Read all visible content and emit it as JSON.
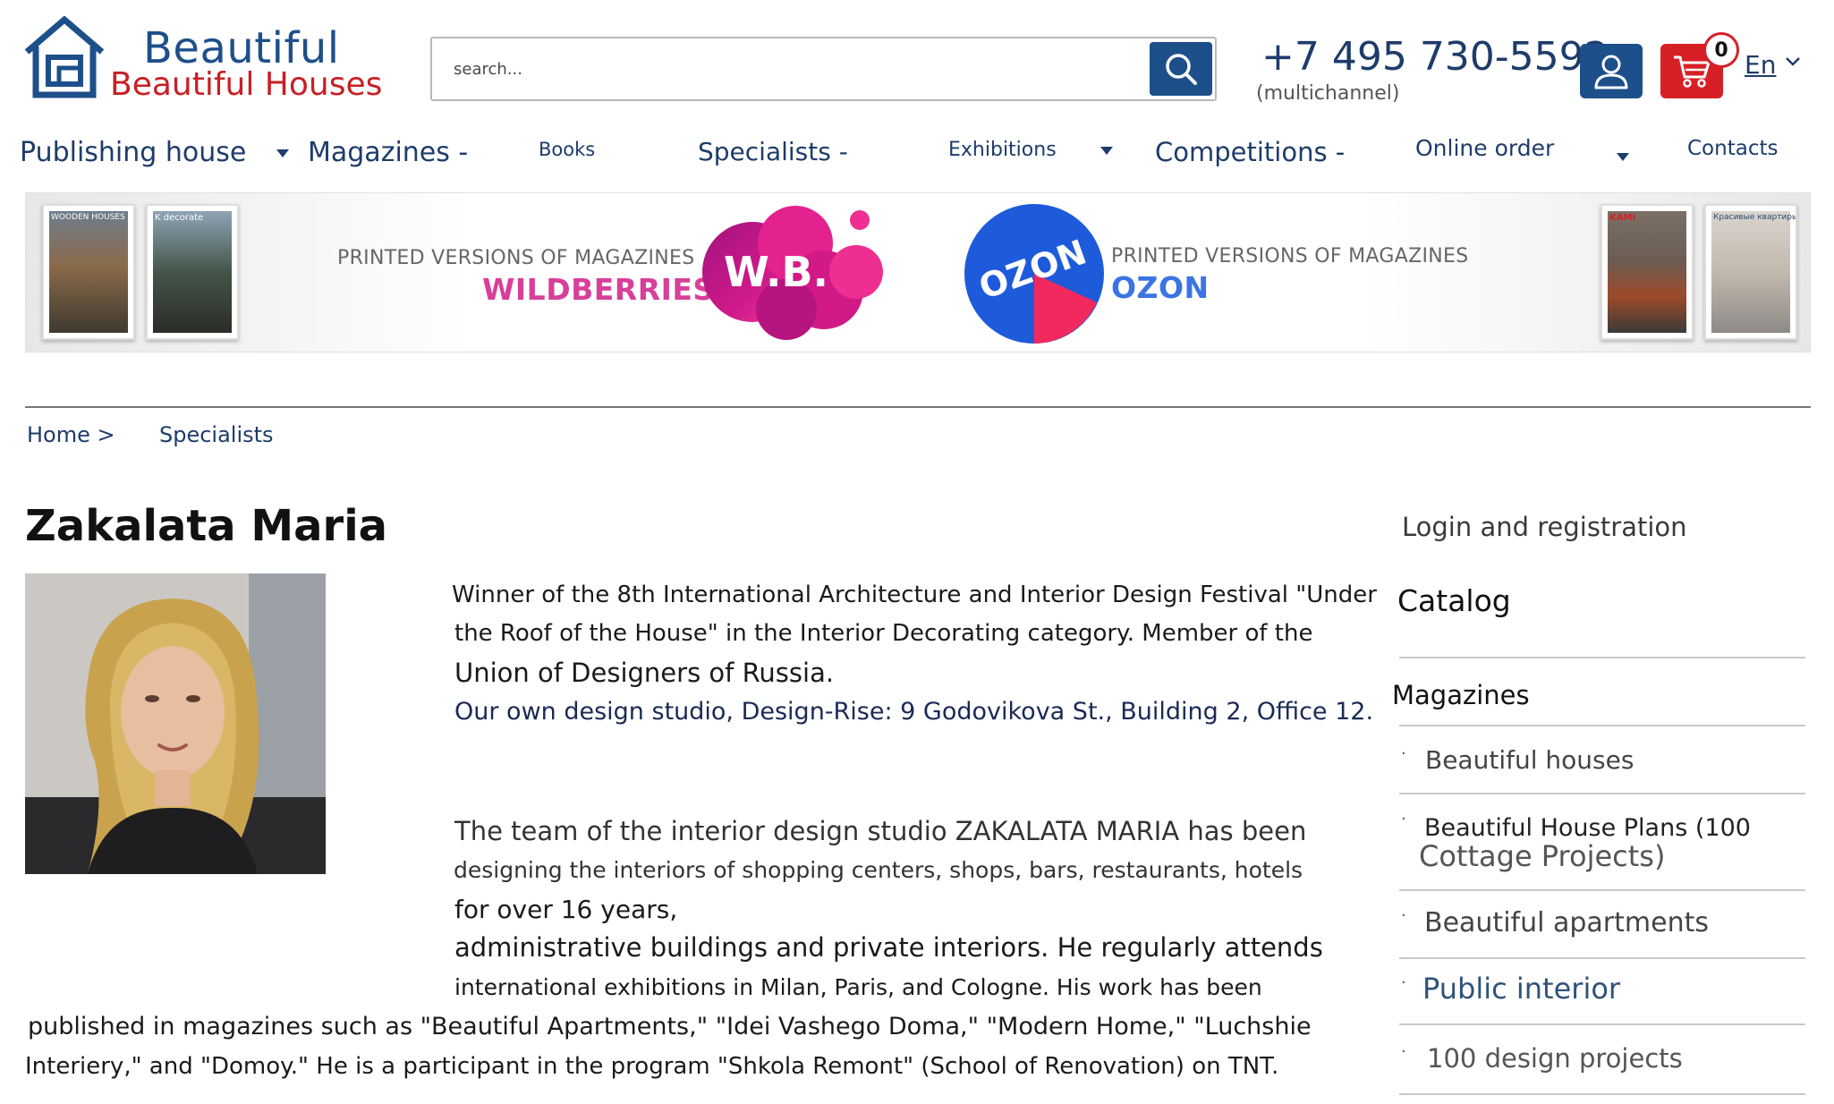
{
  "header": {
    "logo_line1": "Beautiful",
    "logo_line2": "Beautiful Houses",
    "search_placeholder": "search...",
    "phone": "+7 495 730-5592",
    "phone_note": "(multichannel)",
    "cart_count": "0",
    "language": "En",
    "colors": {
      "brand_blue": "#1d4f8a",
      "brand_red": "#d71f26"
    }
  },
  "nav": {
    "items": [
      {
        "label": "Publishing house",
        "dropdown": true
      },
      {
        "label": "Magazines -",
        "dropdown": false
      },
      {
        "label": "Books",
        "dropdown": false
      },
      {
        "label": "Specialists -",
        "dropdown": false
      },
      {
        "label": "Exhibitions",
        "dropdown": true
      },
      {
        "label": "Competitions -",
        "dropdown": false
      },
      {
        "label": "Online order",
        "dropdown": true
      },
      {
        "label": "Contacts",
        "dropdown": false
      }
    ]
  },
  "banner": {
    "left_caption": "PRINTED VERSIONS OF MAGAZINES",
    "left_store": "WILDBERRIES",
    "wb_badge": "W.B.",
    "right_caption": "PRINTED VERSIONS OF MAGAZINES",
    "right_store": "OZON",
    "ozon_badge": "OZON",
    "mag1_title": "WOODEN HOUSES",
    "mag2_title": "K decorate",
    "mag3_title": "KAMI",
    "mag4_title": "Красивые квартиры"
  },
  "breadcrumb": {
    "home": "Home >",
    "current": "Specialists"
  },
  "profile": {
    "name": "Zakalata Maria",
    "lines": [
      "Winner of the 8th International Architecture and Interior Design Festival \"Under",
      "the Roof of the House\" in the Interior Decorating category. Member of the",
      "Union of Designers of Russia.",
      "Our own design studio, Design-Rise: 9 Godovikova St., Building 2, Office 12.",
      "The team of the interior design studio ZAKALATA MARIA has been",
      "designing the interiors of shopping centers, shops, bars, restaurants, hotels",
      "for over 16 years,",
      "administrative buildings and private interiors. He regularly attends",
      "international exhibitions in Milan, Paris, and Cologne. His work has been",
      "published in magazines such as \"Beautiful Apartments,\" \"Idei Vashego Doma,\" \"Modern Home,\" \"Luchshie",
      "Interiery,\" and \"Domoy.\" He is a participant in the program \"Shkola Remont\" (School of Renovation) on TNT."
    ]
  },
  "sidebar": {
    "login": "Login and registration",
    "catalog": "Catalog",
    "magazines": "Magazines",
    "items": [
      "Beautiful houses",
      "Beautiful House Plans (100",
      "Cottage Projects)",
      "Beautiful apartments",
      "Public interior",
      "100 design projects"
    ]
  }
}
